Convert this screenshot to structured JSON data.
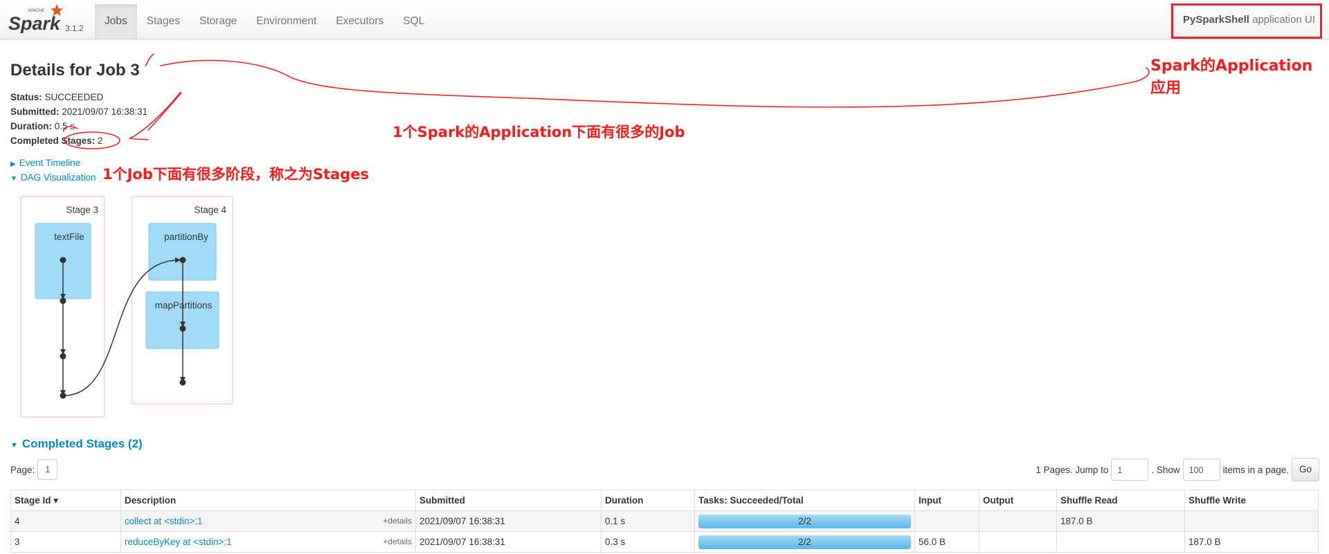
{
  "navbar": {
    "logo_apache": "APACHE",
    "logo_text": "Spark",
    "version": "3.1.2",
    "tabs": [
      {
        "label": "Jobs",
        "active": true
      },
      {
        "label": "Stages",
        "active": false
      },
      {
        "label": "Storage",
        "active": false
      },
      {
        "label": "Environment",
        "active": false
      },
      {
        "label": "Executors",
        "active": false
      },
      {
        "label": "SQL",
        "active": false
      }
    ],
    "app_name": "PySparkShell",
    "app_suffix": "application UI"
  },
  "details": {
    "title": "Details for Job 3",
    "status_label": "Status:",
    "status_value": "SUCCEEDED",
    "submitted_label": "Submitted:",
    "submitted_value": "2021/09/07 16:38:31",
    "duration_label": "Duration:",
    "duration_value": "0.5 s",
    "completed_stages_label": "Completed Stages:",
    "completed_stages_value": "2"
  },
  "toggles": {
    "event_timeline": "Event Timeline",
    "dag_visualization": "DAG Visualization"
  },
  "dag": {
    "stages": [
      {
        "label": "Stage 3",
        "ops": [
          "textFile"
        ]
      },
      {
        "label": "Stage 4",
        "ops": [
          "partitionBy",
          "mapPartitions"
        ]
      }
    ]
  },
  "completed_stages": {
    "title": "Completed Stages (2)",
    "page_label": "Page:",
    "page_current": "1",
    "pages_text": "1 Pages. Jump to",
    "jump_value": "1",
    "show_text": ". Show",
    "show_value": "100",
    "items_text": "items in a page.",
    "go_label": "Go",
    "columns": [
      "Stage Id ▾",
      "Description",
      "Submitted",
      "Duration",
      "Tasks: Succeeded/Total",
      "Input",
      "Output",
      "Shuffle Read",
      "Shuffle Write"
    ],
    "rows": [
      {
        "stage_id": "4",
        "description": "collect at <stdin>:1",
        "details": "+details",
        "submitted": "2021/09/07 16:38:31",
        "duration": "0.1 s",
        "tasks": "2/2",
        "tasks_fraction": 1.0,
        "input": "",
        "output": "",
        "shuffle_read": "187.0 B",
        "shuffle_write": ""
      },
      {
        "stage_id": "3",
        "description": "reduceByKey at <stdin>:1",
        "details": "+details",
        "submitted": "2021/09/07 16:38:31",
        "duration": "0.3 s",
        "tasks": "2/2",
        "tasks_fraction": 1.0,
        "input": "56.0 B",
        "output": "",
        "shuffle_read": "",
        "shuffle_write": "187.0 B"
      }
    ]
  },
  "annotations": {
    "application": "Spark的Application",
    "application_cn": "应用",
    "jobs": "1个Spark的Application下面有很多的Job",
    "stages": "1个Job下面有很多阶段，称之为Stages"
  },
  "colors": {
    "link": "#0088cc",
    "annotation": "#ff1a1a",
    "dag_cluster_border": "#ffc0cb",
    "dag_node_fill": "#a0dcf8",
    "progress_fill": "#58b8ea"
  }
}
